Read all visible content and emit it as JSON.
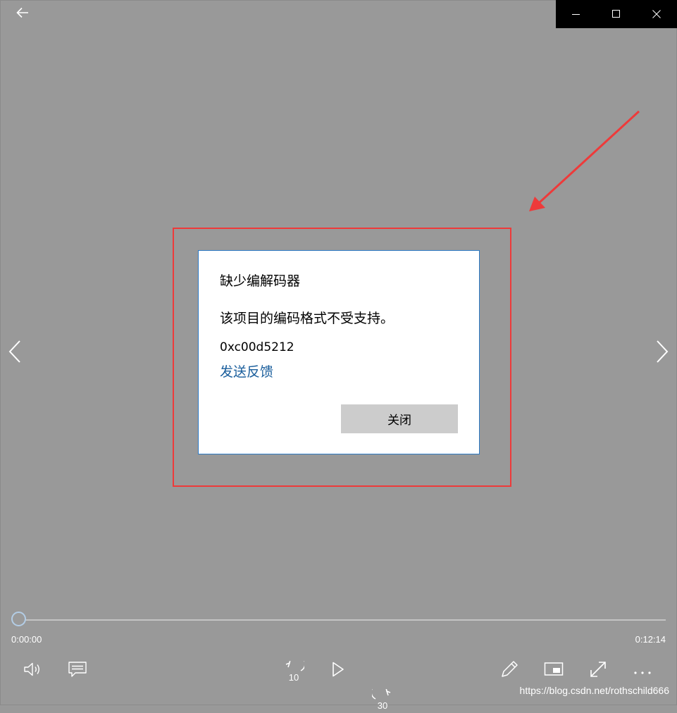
{
  "dialog": {
    "title": "缺少编解码器",
    "message": "该项目的编码格式不受支持。",
    "error_code": "0xc00d5212",
    "feedback_link": "发送反馈",
    "close_label": "关闭"
  },
  "playback": {
    "current_time": "0:00:00",
    "total_time": "0:12:14",
    "progress": 0,
    "skip_back_seconds": "10",
    "skip_forward_seconds": "30"
  },
  "watermark": "https://blog.csdn.net/rothschild666",
  "colors": {
    "background": "#999999",
    "dialog_border": "#2b79c5",
    "link": "#1a5e9c",
    "annotation": "#ee3a3a",
    "close_button": "#cccccc"
  },
  "icons": {
    "back": "back-arrow-icon",
    "minimize": "minimize-icon",
    "maximize": "maximize-icon",
    "close": "close-icon",
    "previous": "chevron-left-icon",
    "next": "chevron-right-icon",
    "volume": "volume-icon",
    "subtitles": "subtitles-icon",
    "skip_back": "skip-back-icon",
    "play": "play-icon",
    "skip_forward": "skip-forward-icon",
    "edit": "pen-icon",
    "mini_view": "mini-view-icon",
    "fullscreen": "fullscreen-icon",
    "more": "more-icon"
  }
}
